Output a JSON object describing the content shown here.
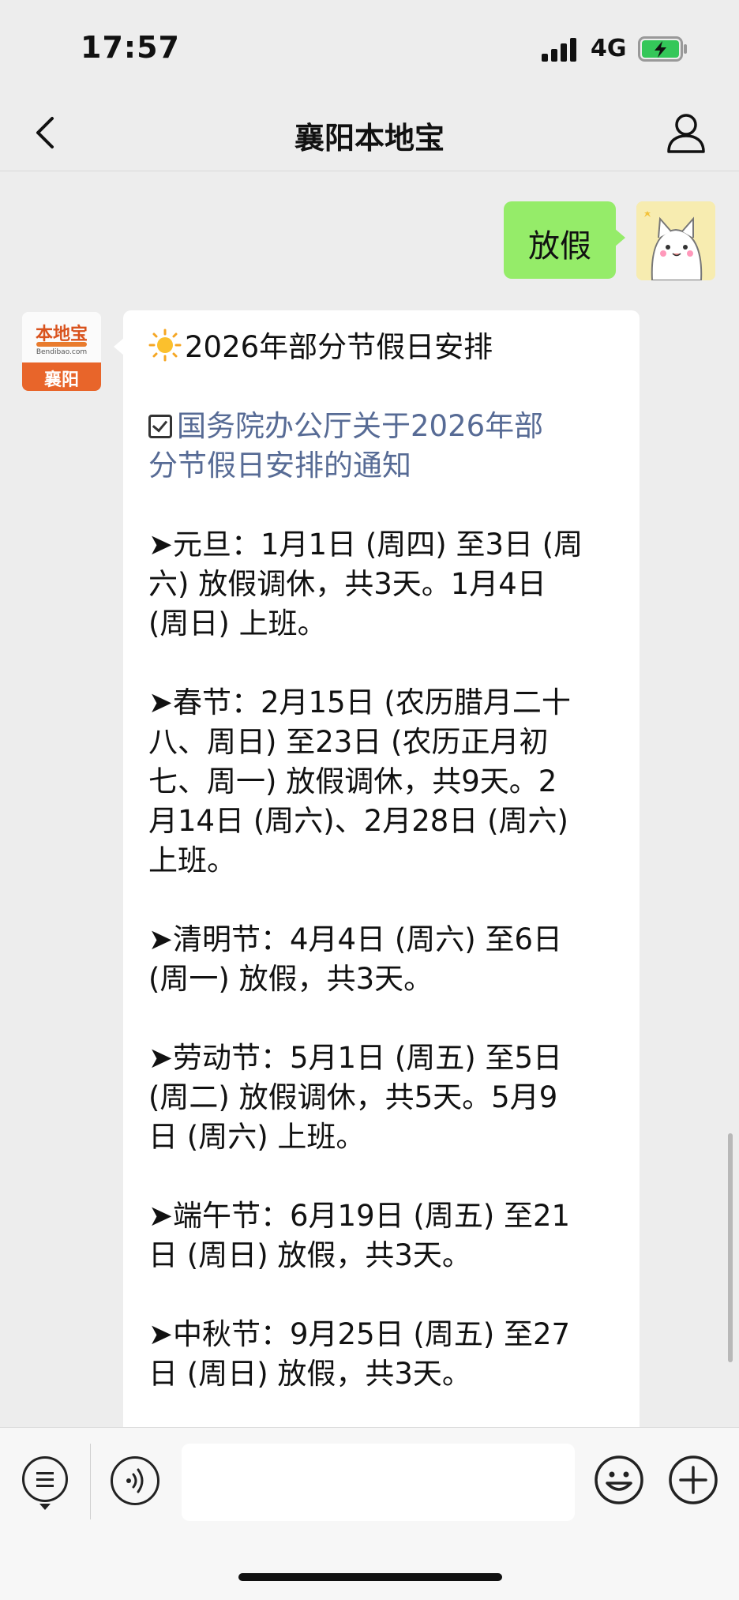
{
  "status_bar": {
    "time": "17:57",
    "network": "4G"
  },
  "nav": {
    "title": "襄阳本地宝",
    "back_icon": "chevron-left-icon",
    "profile_icon": "person-icon"
  },
  "chat": {
    "user_message": "放假",
    "bot_avatar": {
      "brand": "本地宝",
      "url": "Bendibao.com",
      "city": "襄阳"
    },
    "bot_message": {
      "lines": [
        "2026年部分节假日安排",
        "",
        "国务院办公厅关于2026年部",
        "分节假日安排的通知",
        "",
        "➤元旦：1月1日 (周四) 至3日 (周",
        "六) 放假调休，共3天。1月4日",
        "(周日) 上班。",
        "",
        "➤春节：2月15日 (农历腊月二十",
        "八、周日) 至23日 (农历正月初",
        "七、周一) 放假调休，共9天。2",
        "月14日 (周六)、2月28日 (周六)",
        "上班。",
        "",
        "➤清明节：4月4日 (周六) 至6日",
        "(周一) 放假，共3天。",
        "",
        "➤劳动节：5月1日 (周五) 至5日",
        "(周二) 放假调休，共5天。5月9",
        "日 (周六) 上班。",
        "",
        "➤端午节：6月19日 (周五) 至21",
        "日 (周日) 放假，共3天。",
        "",
        "➤中秋节：9月25日 (周五) 至27",
        "日 (周日) 放假，共3天。"
      ]
    }
  },
  "input_bar": {
    "menu_icon": "list-menu-icon",
    "voice_icon": "voice-icon",
    "emoji_icon": "emoji-icon",
    "plus_icon": "plus-icon"
  },
  "colors": {
    "my_bubble": "#95ec69",
    "link": "#576b95",
    "brand_orange": "#e8652a"
  }
}
